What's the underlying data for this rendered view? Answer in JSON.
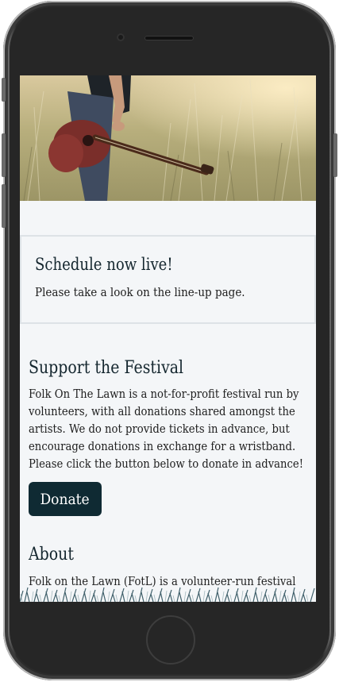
{
  "notice": {
    "title": "Schedule now live!",
    "text": "Please take a look on the line-up page."
  },
  "support": {
    "title": "Support the Festival",
    "body_lines": [
      "Folk On The Lawn is a not-for-profit festival run by",
      "volunteers, with all donations shared amongst the",
      "artists. We do not provide tickets in advance, but",
      "encourage donations in exchange for a wristband.",
      "Please click the button below to donate in advance!"
    ],
    "donate_label": "Donate"
  },
  "about": {
    "title": "About",
    "body_line": "Folk on the Lawn (FotL) is a volunteer-run festival"
  },
  "colors": {
    "page_background": "#f4f6f8",
    "button_background": "#0f2a33",
    "heading_text": "#14262e"
  },
  "icons": {
    "hero": "guitar-in-field-photo",
    "footer": "grass-decoration"
  }
}
